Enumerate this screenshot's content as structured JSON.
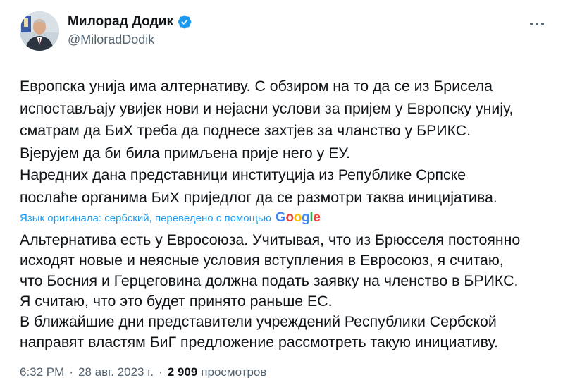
{
  "author": {
    "display_name": "Милорад Додик",
    "handle": "@MiloradDodik",
    "verified": true,
    "verified_color": "#1d9bf0"
  },
  "tweet": {
    "original_text": "Европска унија има алтернативу. С обзиром на то да се из Брисела\nиспостављају увијек нови и нејасни услови за пријем у Европску унију,\nсматрам да БиХ треба да поднесе захтјев за чланство у БРИКС.\nВјерујем да би била примљена прије него у ЕУ.\nНаредних дана представници институција из Републике Српске\nпослаће органима БиХ приједлог да се размотри таква иницијатива.",
    "translation_notice": "Язык оригинала: сербский, переведено с помощью",
    "translation_provider": "Google",
    "translated_text": "Альтернатива есть у Евросоюза. Учитывая, что из Брюсселя постоянно\nисходят новые и неясные условия вступления в Евросоюз, я считаю,\nчто Босния и Герцеговина должна подать заявку на членство в БРИКС.\nЯ считаю, что это будет принято раньше ЕС.\nВ ближайшие дни представители учреждений Республики Сербской\nнаправят властям БиГ предложение рассмотреть такую инициативу."
  },
  "meta": {
    "time": "6:32 PM",
    "separator": "·",
    "date": "28 авг. 2023 г.",
    "views_count": "2 909",
    "views_label": "просмотров"
  },
  "icons": {
    "more": "more-horizontal-icon",
    "verified": "verified-badge-icon"
  },
  "colors": {
    "text": "#0f1419",
    "secondary": "#536471",
    "link": "#1d9bf0"
  }
}
